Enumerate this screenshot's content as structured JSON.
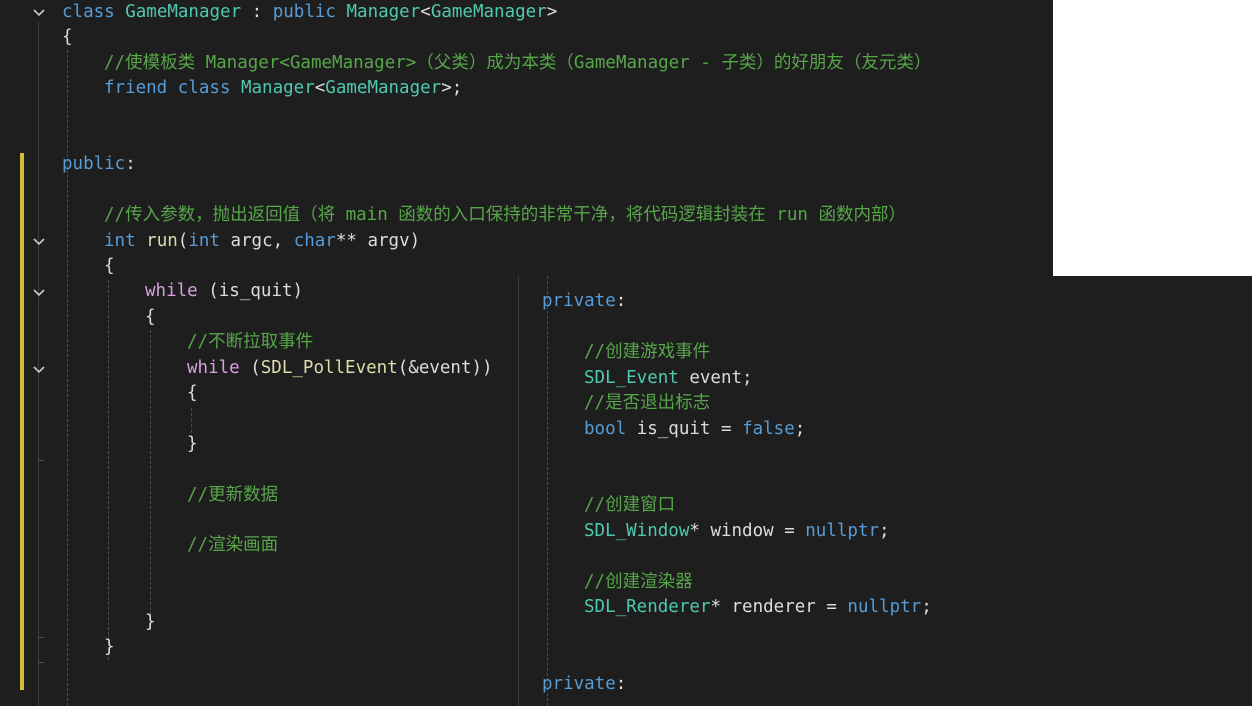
{
  "editor": {
    "lines": [
      [
        {
          "t": "class ",
          "c": "kw"
        },
        {
          "t": "GameManager",
          "c": "typ"
        },
        {
          "t": " : ",
          "c": "txt"
        },
        {
          "t": "public ",
          "c": "kw"
        },
        {
          "t": "Manager",
          "c": "typ"
        },
        {
          "t": "<",
          "c": "txt"
        },
        {
          "t": "GameManager",
          "c": "typ"
        },
        {
          "t": ">",
          "c": "txt"
        }
      ],
      [
        {
          "t": "{",
          "c": "txt"
        }
      ],
      [
        {
          "t": "//使模板类 Manager<GameManager>（父类）成为本类（GameManager - 子类）的好朋友（友元类）",
          "c": "cmt"
        }
      ],
      [
        {
          "t": "friend ",
          "c": "kw"
        },
        {
          "t": "class ",
          "c": "kw"
        },
        {
          "t": "Manager",
          "c": "typ"
        },
        {
          "t": "<",
          "c": "txt"
        },
        {
          "t": "GameManager",
          "c": "typ"
        },
        {
          "t": ">;",
          "c": "txt"
        }
      ],
      [],
      [],
      [
        {
          "t": "public",
          "c": "kw"
        },
        {
          "t": ":",
          "c": "txt"
        }
      ],
      [],
      [
        {
          "t": "//传入参数，抛出返回值（将 main 函数的入口保持的非常干净，将代码逻辑封装在 run 函数内部）",
          "c": "cmt"
        }
      ],
      [
        {
          "t": "int ",
          "c": "kw"
        },
        {
          "t": "run",
          "c": "fn"
        },
        {
          "t": "(",
          "c": "txt"
        },
        {
          "t": "int ",
          "c": "kw"
        },
        {
          "t": "argc",
          "c": "var"
        },
        {
          "t": ", ",
          "c": "txt"
        },
        {
          "t": "char",
          "c": "kw"
        },
        {
          "t": "** ",
          "c": "txt"
        },
        {
          "t": "argv",
          "c": "var"
        },
        {
          "t": ")",
          "c": "txt"
        }
      ],
      [
        {
          "t": "{",
          "c": "txt"
        }
      ],
      [
        {
          "t": "while ",
          "c": "ctl"
        },
        {
          "t": "(",
          "c": "txt"
        },
        {
          "t": "is_quit",
          "c": "var"
        },
        {
          "t": ")",
          "c": "txt"
        }
      ],
      [
        {
          "t": "{",
          "c": "txt"
        }
      ],
      [
        {
          "t": "//不断拉取事件",
          "c": "cmt"
        }
      ],
      [
        {
          "t": "while ",
          "c": "ctl"
        },
        {
          "t": "(",
          "c": "txt"
        },
        {
          "t": "SDL_PollEvent",
          "c": "fn"
        },
        {
          "t": "(&",
          "c": "txt"
        },
        {
          "t": "event",
          "c": "var"
        },
        {
          "t": "))",
          "c": "txt"
        }
      ],
      [
        {
          "t": "{",
          "c": "txt"
        }
      ],
      [],
      [
        {
          "t": "}",
          "c": "txt"
        }
      ],
      [],
      [
        {
          "t": "//更新数据",
          "c": "cmt"
        }
      ],
      [],
      [
        {
          "t": "//渲染画面",
          "c": "cmt"
        }
      ],
      [],
      [],
      [
        {
          "t": "}",
          "c": "txt"
        }
      ],
      [
        {
          "t": "}",
          "c": "txt"
        }
      ]
    ]
  },
  "second_pane": {
    "lines": [
      [
        {
          "t": "private",
          "c": "kw"
        },
        {
          "t": ":",
          "c": "txt"
        }
      ],
      [],
      [
        {
          "t": "//创建游戏事件",
          "c": "cmt"
        }
      ],
      [
        {
          "t": "SDL_Event ",
          "c": "typ"
        },
        {
          "t": "event",
          "c": "var"
        },
        {
          "t": ";",
          "c": "txt"
        }
      ],
      [
        {
          "t": "//是否退出标志",
          "c": "cmt"
        }
      ],
      [
        {
          "t": "bool ",
          "c": "kw"
        },
        {
          "t": "is_quit",
          "c": "var"
        },
        {
          "t": " = ",
          "c": "txt"
        },
        {
          "t": "false",
          "c": "kw"
        },
        {
          "t": ";",
          "c": "txt"
        }
      ],
      [],
      [],
      [
        {
          "t": "//创建窗口",
          "c": "cmt"
        }
      ],
      [
        {
          "t": "SDL_Window",
          "c": "typ"
        },
        {
          "t": "* ",
          "c": "txt"
        },
        {
          "t": "window",
          "c": "var"
        },
        {
          "t": " = ",
          "c": "txt"
        },
        {
          "t": "nullptr",
          "c": "kw"
        },
        {
          "t": ";",
          "c": "txt"
        }
      ],
      [],
      [
        {
          "t": "//创建渲染器",
          "c": "cmt"
        }
      ],
      [
        {
          "t": "SDL_Renderer",
          "c": "typ"
        },
        {
          "t": "* ",
          "c": "txt"
        },
        {
          "t": "renderer",
          "c": "var"
        },
        {
          "t": " = ",
          "c": "txt"
        },
        {
          "t": "nullptr",
          "c": "kw"
        },
        {
          "t": ";",
          "c": "txt"
        }
      ],
      [],
      [],
      [
        {
          "t": "private",
          "c": "kw"
        },
        {
          "t": ":",
          "c": "txt"
        }
      ]
    ]
  },
  "fold_icons": [
    "chevron-down-icon"
  ]
}
